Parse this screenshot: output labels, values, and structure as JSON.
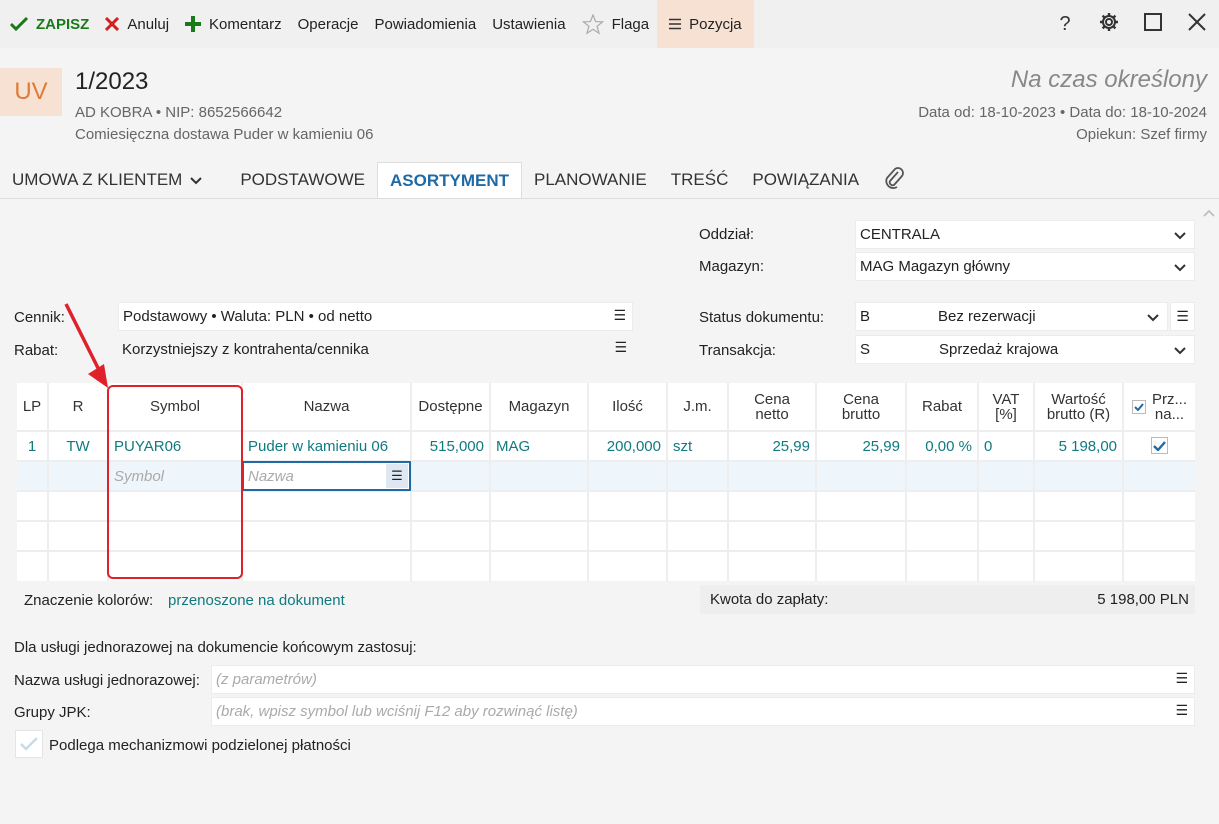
{
  "toolbar": {
    "save": "ZAPISZ",
    "cancel": "Anuluj",
    "comment": "Komentarz",
    "operations": "Operacje",
    "notifications": "Powiadomienia",
    "settings": "Ustawienia",
    "flag": "Flaga",
    "position": "Pozycja"
  },
  "header": {
    "badge": "UV",
    "number": "1/2023",
    "contractor": "AD KOBRA  •  NIP: 8652566642",
    "description": "Comiesięczna dostawa Puder w kamieniu 06",
    "term": "Na czas określony",
    "dates": "Data od: 18-10-2023  •  Data do: 18-10-2024",
    "guardian": "Opiekun: Szef firmy"
  },
  "tabs": [
    "UMOWA Z KLIENTEM",
    "PODSTAWOWE",
    "ASORTYMENT",
    "PLANOWANIE",
    "TREŚĆ",
    "POWIĄZANIA"
  ],
  "form": {
    "branch_label": "Oddział:",
    "branch_value": "CENTRALA",
    "warehouse_label": "Magazyn:",
    "warehouse_value": "MAG  Magazyn główny",
    "pricelist_label": "Cennik:",
    "pricelist_value": "Podstawowy • Waluta: PLN • od netto",
    "discount_label": "Rabat:",
    "discount_value": "Korzystniejszy z kontrahenta/cennika",
    "status_label": "Status dokumentu:",
    "status_code": "B",
    "status_value": "Bez rezerwacji",
    "transaction_label": "Transakcja:",
    "transaction_code": "S",
    "transaction_value": "Sprzedaż krajowa"
  },
  "grid": {
    "headers": {
      "lp": "LP",
      "r": "R",
      "symbol": "Symbol",
      "name": "Nazwa",
      "available": "Dostępne",
      "warehouse": "Magazyn",
      "qty": "Ilość",
      "unit": "J.m.",
      "net1": "Cena",
      "net2": "netto",
      "gross1": "Cena",
      "gross2": "brutto",
      "discount": "Rabat",
      "vat1": "VAT",
      "vat2": "[%]",
      "value1": "Wartość",
      "value2": "brutto (R)",
      "transfer1": "Prz...",
      "transfer2": "na..."
    },
    "row": {
      "lp": "1",
      "r": "TW",
      "symbol": "PUYAR06",
      "name": "Puder w kamieniu 06",
      "available": "515,000",
      "warehouse": "MAG",
      "qty": "200,000",
      "unit": "szt",
      "net": "25,99",
      "gross": "25,99",
      "discount": "0,00 %",
      "vat": "0",
      "value": "5 198,00"
    },
    "new_row": {
      "symbol_placeholder": "Symbol",
      "name_placeholder": "Nazwa"
    }
  },
  "legend": {
    "label": "Znaczenie kolorów:",
    "value": "przenoszone na dokument"
  },
  "total": {
    "label": "Kwota do zapłaty:",
    "value": "5 198,00 PLN"
  },
  "oneoff": {
    "title": "Dla usługi jednorazowej na dokumencie końcowym zastosuj:",
    "service_label": "Nazwa usługi jednorazowej:",
    "service_placeholder": "(z parametrów)",
    "jpk_label": "Grupy JPK:",
    "jpk_placeholder": "(brak, wpisz symbol lub wciśnij F12 aby rozwinąć listę)",
    "split_payment": "Podlega mechanizmowi podzielonej płatności"
  },
  "colors": {
    "accent": "#1f6aa5",
    "teal": "#0f7a80",
    "badge_bg": "#f7e1d3",
    "badge_fg": "#e07a3a",
    "highlight": "#e0202a"
  }
}
